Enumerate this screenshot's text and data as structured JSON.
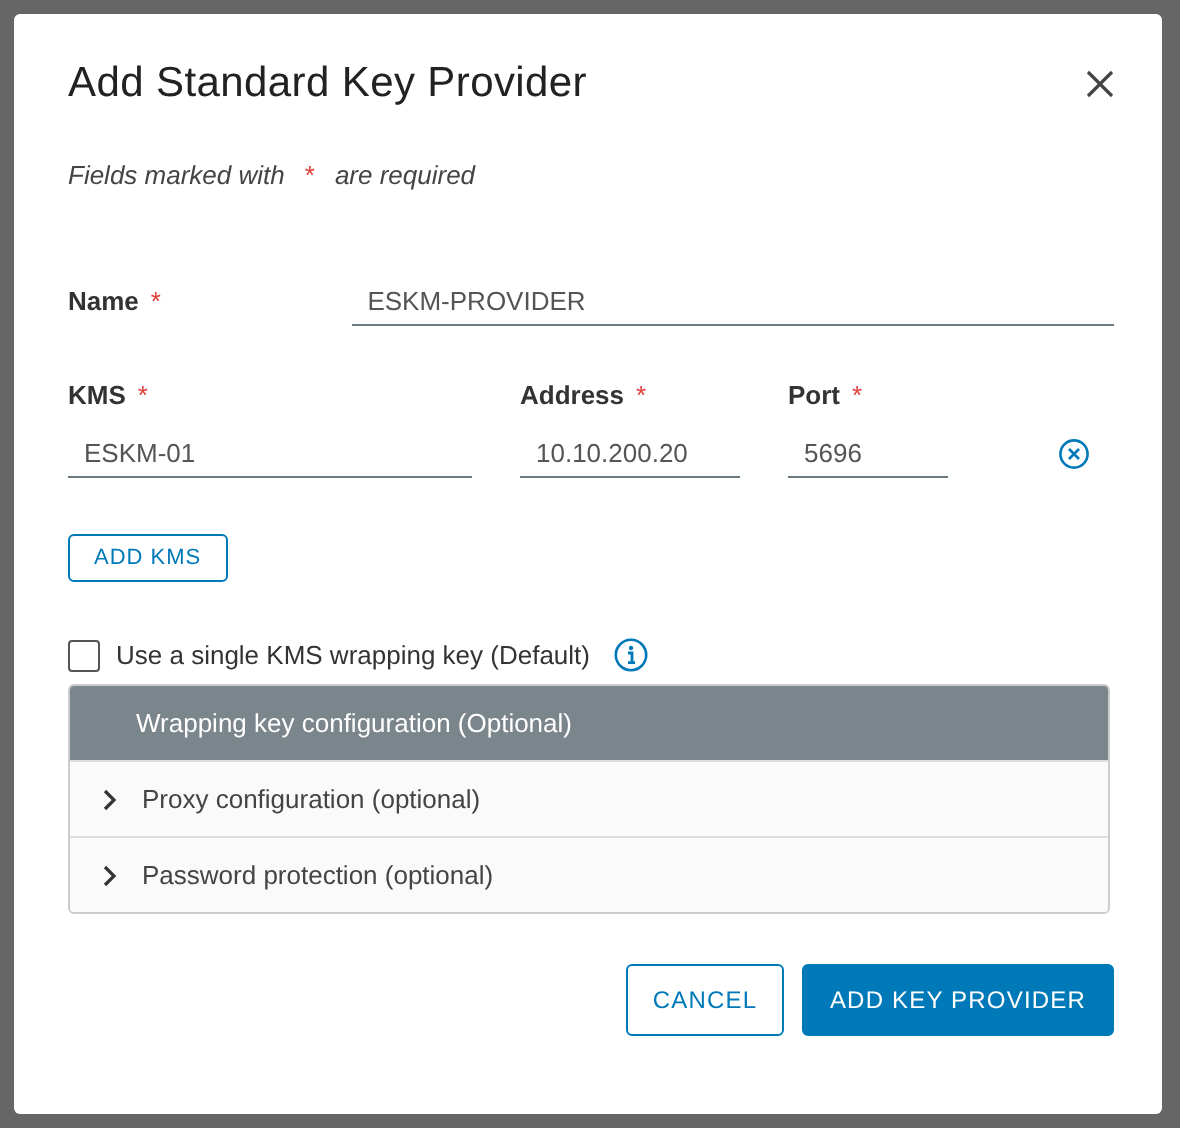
{
  "dialog": {
    "title": "Add Standard Key Provider",
    "required_note": {
      "before": "Fields marked with",
      "mark": "*",
      "after": "are required"
    },
    "name_field": {
      "label": "Name",
      "required": true,
      "value": "ESKM-PROVIDER"
    },
    "kms_row": [
      {
        "label": "KMS",
        "required": true,
        "value": "ESKM-01"
      },
      {
        "label": "Address",
        "required": true,
        "value": "10.10.200.20"
      },
      {
        "label": "Port",
        "required": true,
        "value": "5696"
      }
    ],
    "add_kms_button": "ADD KMS",
    "single_key_checkbox": {
      "label": "Use a single KMS wrapping key (Default)",
      "checked": false
    },
    "panels": [
      {
        "title": "Wrapping key configuration (Optional)",
        "disabled": true
      },
      {
        "title": "Proxy configuration (optional)",
        "disabled": false,
        "expanded": false
      },
      {
        "title": "Password protection (optional)",
        "disabled": false,
        "expanded": false
      }
    ],
    "buttons": [
      {
        "label": "CANCEL",
        "kind": "outline"
      },
      {
        "label": "ADD KEY PROVIDER",
        "kind": "primary"
      }
    ]
  }
}
